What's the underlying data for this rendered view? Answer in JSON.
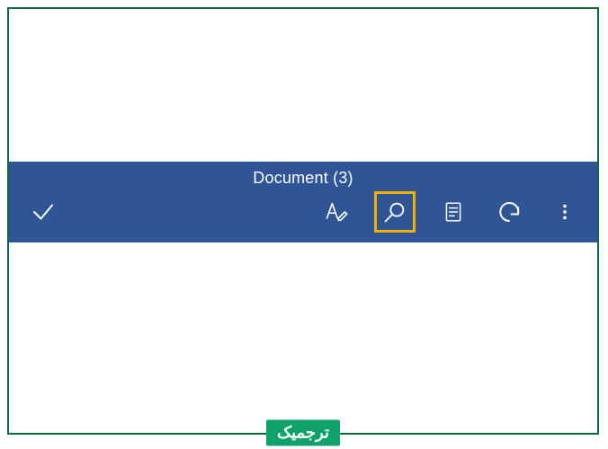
{
  "title": "Document (3)",
  "icons": {
    "confirm": "checkmark-icon",
    "text_edit": "text-pen-icon",
    "search": "search-icon",
    "reader": "page-layout-icon",
    "undo": "undo-icon",
    "more": "more-vertical-icon"
  },
  "highlighted_tool": "search",
  "colors": {
    "toolbar_bg": "#2f5597",
    "highlight_border": "#f2b100",
    "frame_border": "#0e6b3f",
    "watermark_bg": "#0fa26a"
  },
  "watermark": "ترجمیک"
}
